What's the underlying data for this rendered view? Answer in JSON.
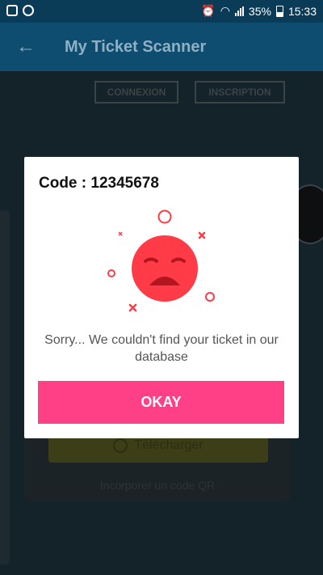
{
  "status_bar": {
    "battery": "35%",
    "time": "15:33"
  },
  "app_bar": {
    "back_icon": "arrow-left-icon",
    "title": "My Ticket Scanner"
  },
  "background": {
    "tab_connexion": "CONNEXION",
    "tab_inscription": "INSCRIPTION",
    "download_button": "Télécharger",
    "embed_link": "Incorporer un code QR"
  },
  "dialog": {
    "code_title": "Code : 12345678",
    "illustration_icon": "sad-face-icon",
    "message": "Sorry... We couldn't find your ticket in our database",
    "okay_label": "OKAY"
  },
  "colors": {
    "accent": "#ff3f86",
    "error": "#ff3b47",
    "appbar": "#0e4d70"
  }
}
